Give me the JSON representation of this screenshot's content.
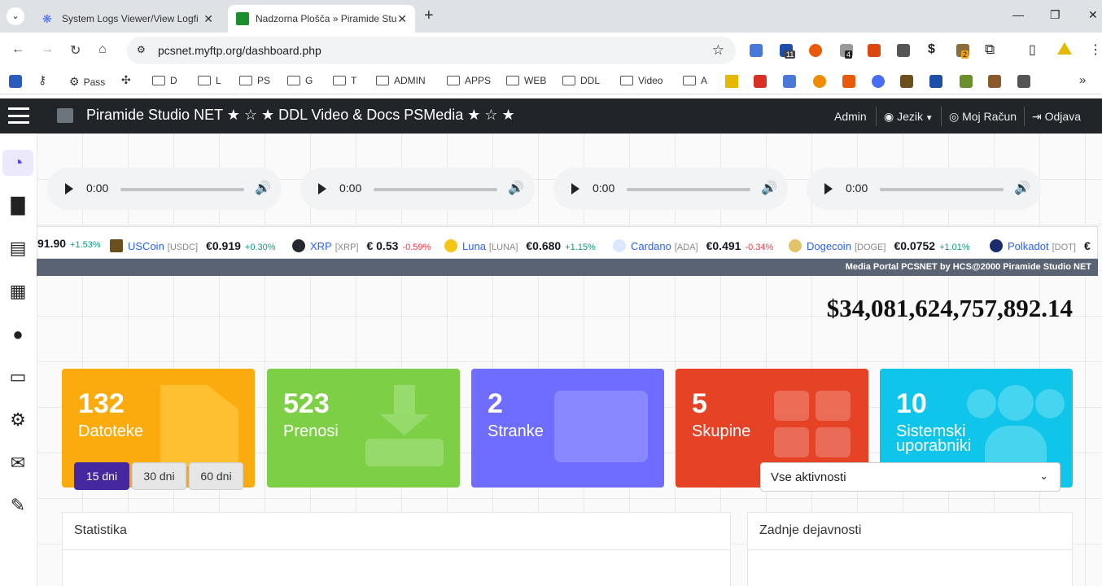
{
  "browser": {
    "tabs": [
      {
        "title": "System Logs Viewer/View Logfi",
        "active": false
      },
      {
        "title": "Nadzorna Plošča » Piramide Stu",
        "active": true
      }
    ],
    "url": "pcsnet.myftp.org/dashboard.php",
    "extension_badges": {
      "ext1": "11",
      "ext2": "4",
      "ext3": "2"
    },
    "bookmarks": [
      {
        "label": "Pass",
        "type": "link"
      },
      {
        "label": "D",
        "type": "folder"
      },
      {
        "label": "L",
        "type": "folder"
      },
      {
        "label": "PS",
        "type": "folder"
      },
      {
        "label": "G",
        "type": "folder"
      },
      {
        "label": "T",
        "type": "folder"
      },
      {
        "label": "ADMIN",
        "type": "folder"
      },
      {
        "label": "APPS",
        "type": "folder"
      },
      {
        "label": "WEB",
        "type": "folder"
      },
      {
        "label": "DDL",
        "type": "folder"
      },
      {
        "label": "Video",
        "type": "folder"
      },
      {
        "label": "A",
        "type": "folder"
      }
    ]
  },
  "topnav": {
    "brand": "Piramide Studio NET ★ ☆ ★ DDL Video & Docs PSMedia ★ ☆ ★",
    "admin": "Admin",
    "language": "Jezik",
    "account": "Moj Račun",
    "logout": "Odjava"
  },
  "sidebar_icons": [
    "dashboard-icon",
    "file-icon",
    "id-card-icon",
    "grid-icon",
    "users-icon",
    "monitor-icon",
    "gear-icon",
    "envelope-icon",
    "wrench-icon"
  ],
  "audio_players": [
    {
      "time": "0:00"
    },
    {
      "time": "0:00"
    },
    {
      "time": "0:00"
    },
    {
      "time": "0:00"
    }
  ],
  "ticker": [
    {
      "name": "",
      "symbol": "",
      "price": "91.90",
      "change": "+1.53%",
      "dir": "up"
    },
    {
      "name": "USCoin",
      "symbol": "[USDC]",
      "price": "€0.919",
      "change": "+0.30%",
      "dir": "up"
    },
    {
      "name": "XRP",
      "symbol": "[XRP]",
      "price": "€ 0.53",
      "change": "-0.59%",
      "dir": "down"
    },
    {
      "name": "Luna",
      "symbol": "[LUNA]",
      "price": "€0.680",
      "change": "+1.15%",
      "dir": "up"
    },
    {
      "name": "Cardano",
      "symbol": "[ADA]",
      "price": "€0.491",
      "change": "-0.34%",
      "dir": "down"
    },
    {
      "name": "Dogecoin",
      "symbol": "[DOGE]",
      "price": "€0.0752",
      "change": "+1.01%",
      "dir": "up"
    },
    {
      "name": "Polkadot",
      "symbol": "[DOT]",
      "price": "€",
      "change": "",
      "dir": "up"
    }
  ],
  "portal_banner": "Media Portal PCSNET by HCS@2000 Piramide Studio NET",
  "big_number": "$34,081,624,757,892.14",
  "cards": [
    {
      "count": "132",
      "label": "Datoteke",
      "color": "#fcab0e"
    },
    {
      "count": "523",
      "label": "Prenosi",
      "color": "#7dcf46"
    },
    {
      "count": "2",
      "label": "Stranke",
      "color": "#6f6dff"
    },
    {
      "count": "5",
      "label": "Skupine",
      "color": "#e54226"
    },
    {
      "count": "10",
      "label": "Sistemski uporabniki",
      "color": "#0fc6ea"
    }
  ],
  "stats_panel": {
    "title": "Statistika",
    "ranges": [
      {
        "label": "15 dni",
        "active": true
      },
      {
        "label": "30 dni",
        "active": false
      },
      {
        "label": "60 dni",
        "active": false
      }
    ]
  },
  "activity_panel": {
    "title": "Zadnje dejavnosti",
    "select_value": "Vse aktivnosti"
  }
}
